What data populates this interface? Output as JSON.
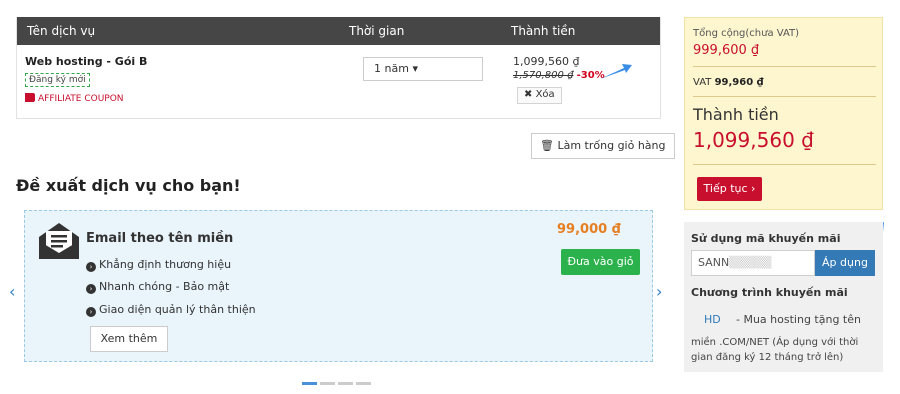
{
  "cart": {
    "headers": {
      "service": "Tên dịch vụ",
      "time": "Thời gian",
      "total": "Thành tiền"
    },
    "item": {
      "name": "Web hosting - Gói B",
      "status": "Đăng ký mới",
      "coupon": "AFFILIATE COUPON",
      "period": "1 năm",
      "price": "1,099,560 ₫",
      "old_price": "1,570,800 ₫",
      "discount": "-30%",
      "remove_label": "Xóa"
    },
    "empty_label": "Làm trống giỏ hàng"
  },
  "suggest": {
    "title": "Đề xuất dịch vụ cho bạn!",
    "card": {
      "title": "Email theo tên miền",
      "features": [
        "Khẳng định thương hiệu",
        "Nhanh chóng - Bảo mật",
        "Giao diện quản lý thân thiện"
      ],
      "price": "99,000 ₫",
      "add_label": "Đưa vào giỏ",
      "more_label": "Xem thêm"
    },
    "carousel_pages": 4,
    "active_page": 1
  },
  "summary": {
    "subtotal_label": "Tổng cộng(chưa VAT)",
    "subtotal": "999,600 ₫",
    "vat_label": "VAT",
    "vat": "99,960 ₫",
    "total_label": "Thành tiền",
    "total": "1,099,560 ₫",
    "continue_label": "Tiếp tục ›"
  },
  "promo": {
    "title": "Sử dụng mã khuyến mãi",
    "code_visible": "SANN",
    "apply_label": "Áp dụng",
    "program_title": "Chương trình khuyến mãi",
    "program_code": "HD",
    "program_desc_1": "- Mua hosting tặng tên",
    "program_desc_2": "miền .COM/NET (Áp dụng với thời gian đăng ký 12 tháng trở lên)"
  },
  "colors": {
    "accent_red": "#c8102e",
    "accent_blue": "#337ab7",
    "accent_green": "#2bb24c",
    "header_dark": "#464646"
  }
}
